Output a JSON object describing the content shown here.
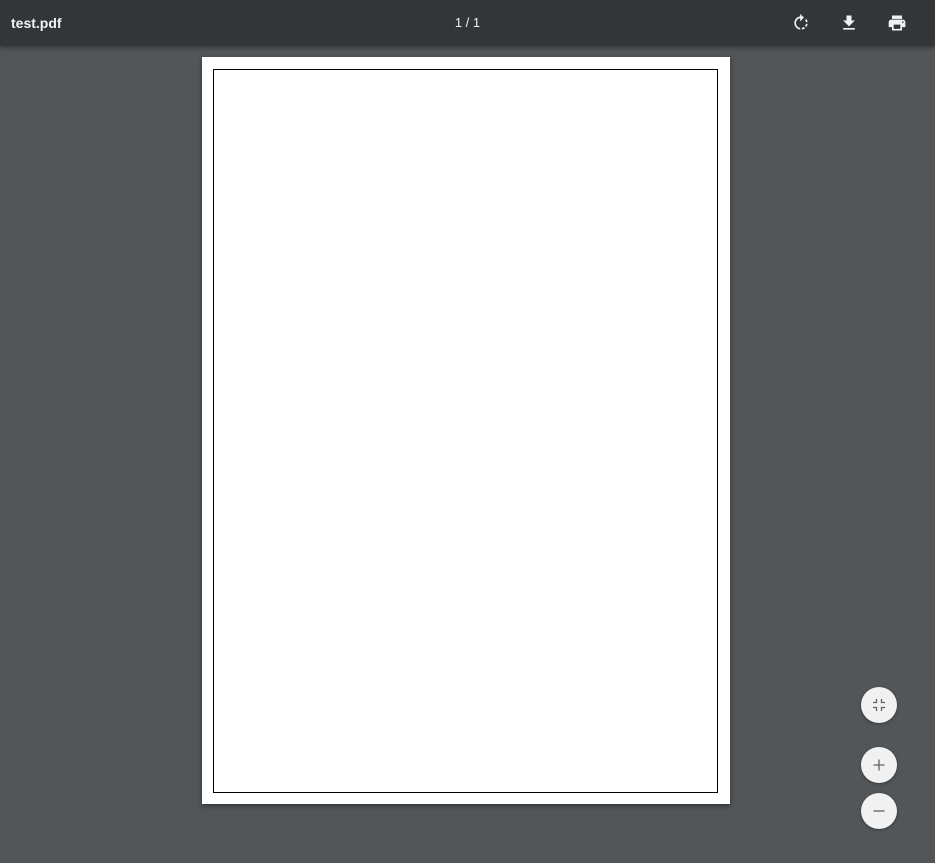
{
  "toolbar": {
    "file_title": "test.pdf",
    "page_indicator": "1 / 1",
    "icons": {
      "rotate": "rotate-icon",
      "download": "download-icon",
      "print": "print-icon"
    }
  },
  "zoom_controls": {
    "icons": {
      "fit": "fit-to-page-icon",
      "zoom_in": "plus-icon",
      "zoom_out": "minus-icon"
    }
  },
  "colors": {
    "toolbar_bg": "#323639",
    "viewer_bg": "#525659",
    "page_bg": "#ffffff",
    "fab_bg": "#f1f1f1",
    "icon_light": "#f1f1f1",
    "icon_dark": "#5f6368"
  }
}
